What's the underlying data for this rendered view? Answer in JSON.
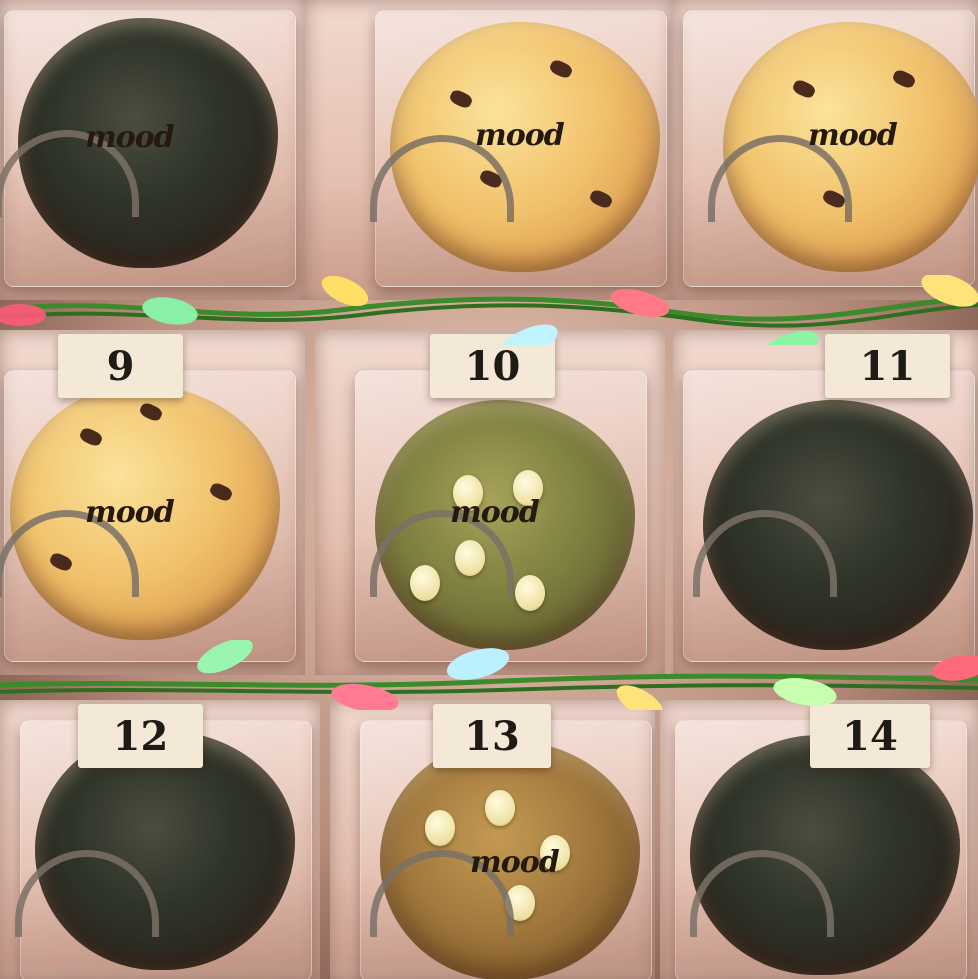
{
  "brand_text": "mood",
  "tags": [
    "9",
    "10",
    "11",
    "12",
    "13",
    "14"
  ]
}
